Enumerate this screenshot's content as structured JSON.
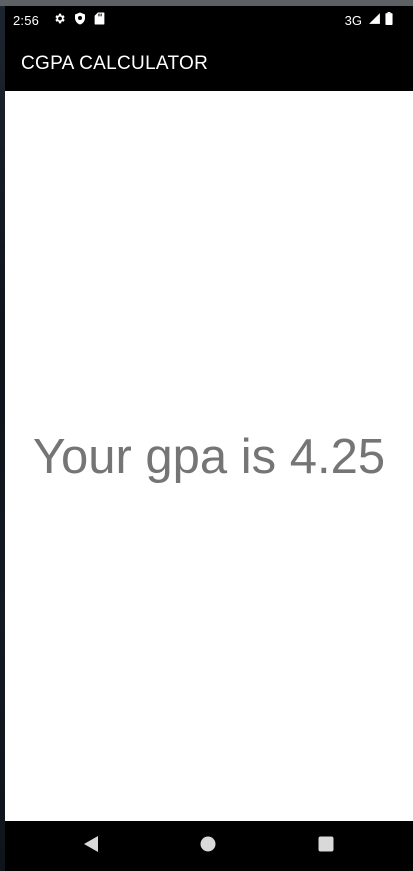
{
  "status_bar": {
    "time": "2:56",
    "network": "3G",
    "icons": [
      "settings-icon",
      "shield-icon",
      "sd-card-icon",
      "signal-icon",
      "battery-icon"
    ]
  },
  "app_bar": {
    "title": "CGPA CALCULATOR",
    "background": "#000000"
  },
  "main": {
    "result_text": "Your gpa is 4.25",
    "text_color": "#757575"
  },
  "nav_bar": {
    "buttons": [
      "back-icon",
      "home-icon",
      "recents-icon"
    ]
  }
}
